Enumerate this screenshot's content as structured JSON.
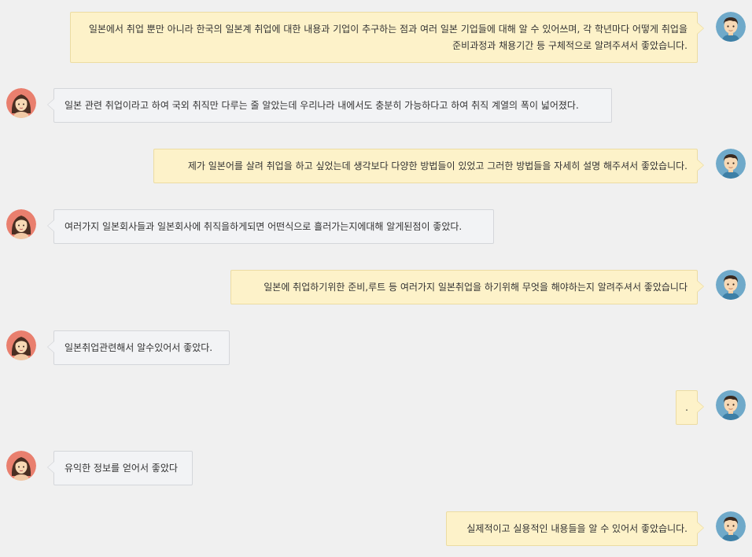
{
  "messages": [
    {
      "side": "right",
      "avatar": "male-avatar-icon",
      "text": "일본에서 취업 뿐만 아니라 한국의 일본계 취업에 대한 내용과 기업이 추구하는 점과 여러 일본 기업들에 대해 알 수 있어쓰며, 각 학년마다 어떻게 취업을 준비과정과 채용기간 등 구체적으로 알려주셔서 좋았습니다."
    },
    {
      "side": "left",
      "avatar": "female-avatar-icon",
      "text": "일본 관련 취업이라고 하여 국외 취직만 다루는 줄 알았는데 우리나라 내에서도 충분히 가능하다고 하여 취직 계열의 폭이 넓어졌다."
    },
    {
      "side": "right",
      "avatar": "male-avatar-icon",
      "text": "제가 일본어를 살려 취업을 하고 싶었는데 생각보다 다양한 방법들이 있었고 그러한 방법들을 자세히 설명 해주셔서 좋았습니다."
    },
    {
      "side": "left",
      "avatar": "female-avatar-icon",
      "text": "여러가지 일본회사들과 일본회사에 취직을하게되면 어떤식으로 흘러가는지에대해 알게된점이 좋았다."
    },
    {
      "side": "right",
      "avatar": "male-avatar-icon",
      "text": "일본에 취업하기위한 준비,루트 등 여러가지 일본취업을 하기위해 무엇을 해야하는지 알려주셔서 좋았습니다"
    },
    {
      "side": "left",
      "avatar": "female-avatar-icon",
      "text": "일본취업관련해서 알수있어서 좋았다."
    },
    {
      "side": "right",
      "avatar": "male-avatar-icon",
      "text": "."
    },
    {
      "side": "left",
      "avatar": "female-avatar-icon",
      "text": "유익한 정보를 얻어서 좋았다"
    },
    {
      "side": "right",
      "avatar": "male-avatar-icon",
      "text": "실제적이고 실용적인 내용들을 알 수 있어서 좋았습니다."
    }
  ],
  "colors": {
    "me_bubble": "#fdf2c9",
    "them_bubble": "#f2f3f5",
    "background": "#f0f0f0"
  }
}
